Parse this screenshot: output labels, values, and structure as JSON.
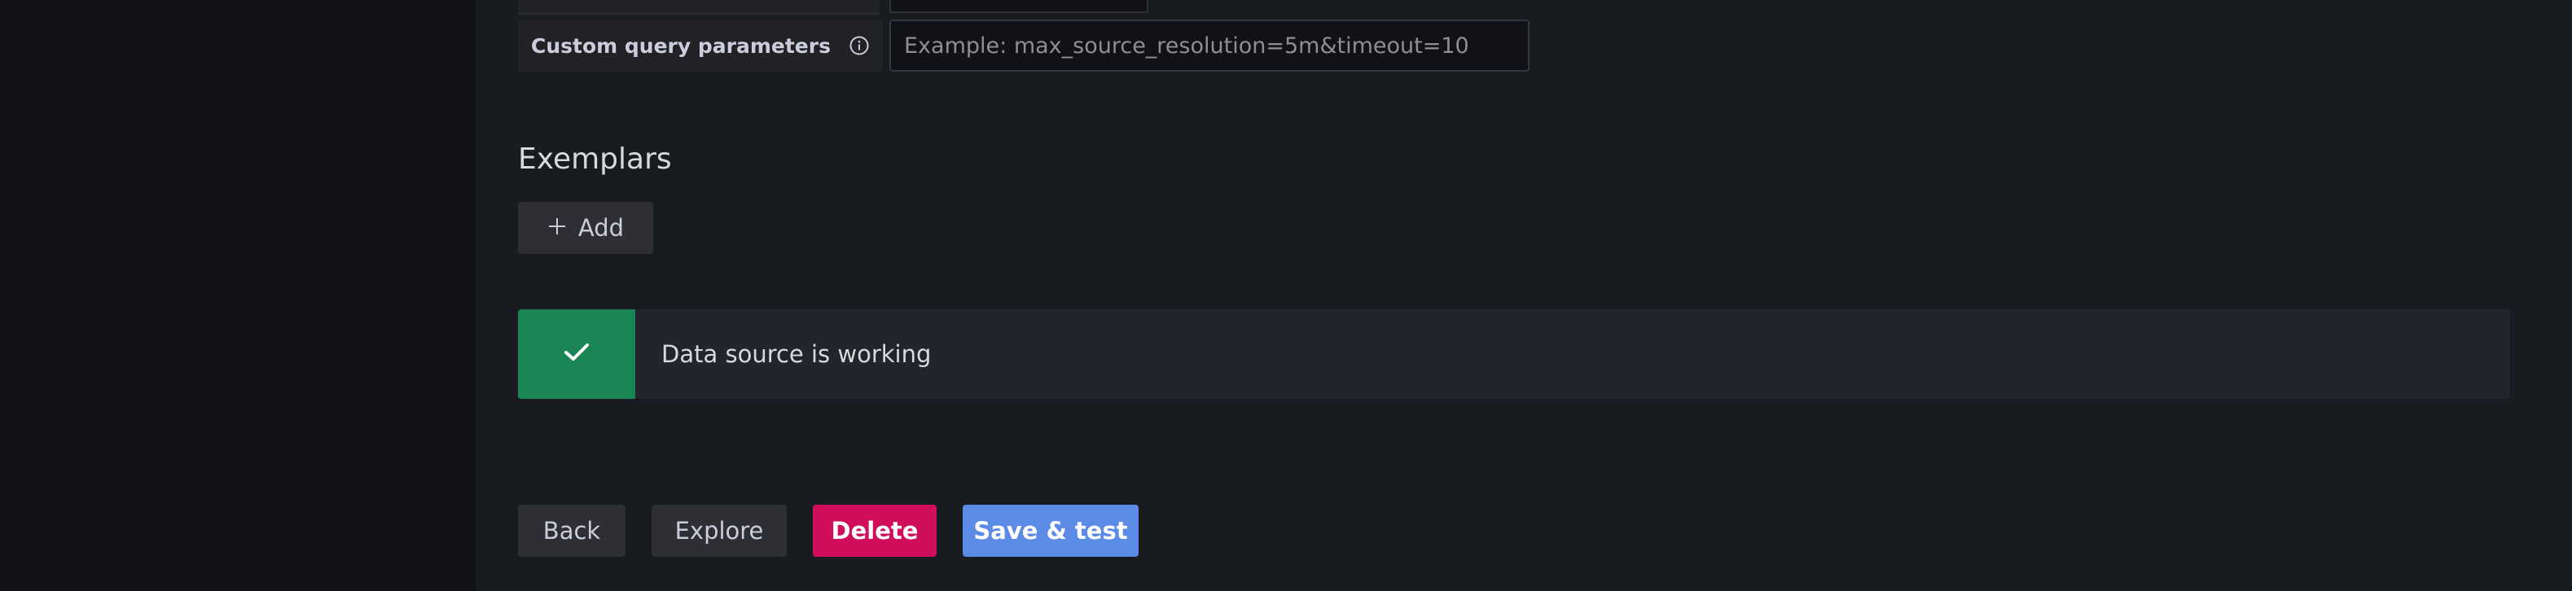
{
  "form": {
    "custom_query_label": "Custom query parameters",
    "custom_query_value": "",
    "custom_query_placeholder": "Example: max_source_resolution=5m&timeout=10"
  },
  "exemplars": {
    "title": "Exemplars",
    "add_label": "Add"
  },
  "alert": {
    "message": "Data source is working",
    "status": "success"
  },
  "actions": {
    "back_label": "Back",
    "explore_label": "Explore",
    "delete_label": "Delete",
    "save_label": "Save & test"
  },
  "colors": {
    "background": "#181b1f",
    "success": "#1b8653",
    "danger": "#d10e5c",
    "primary": "#5b8be6"
  },
  "icons": [
    "info-icon",
    "plus-icon",
    "check-icon"
  ]
}
